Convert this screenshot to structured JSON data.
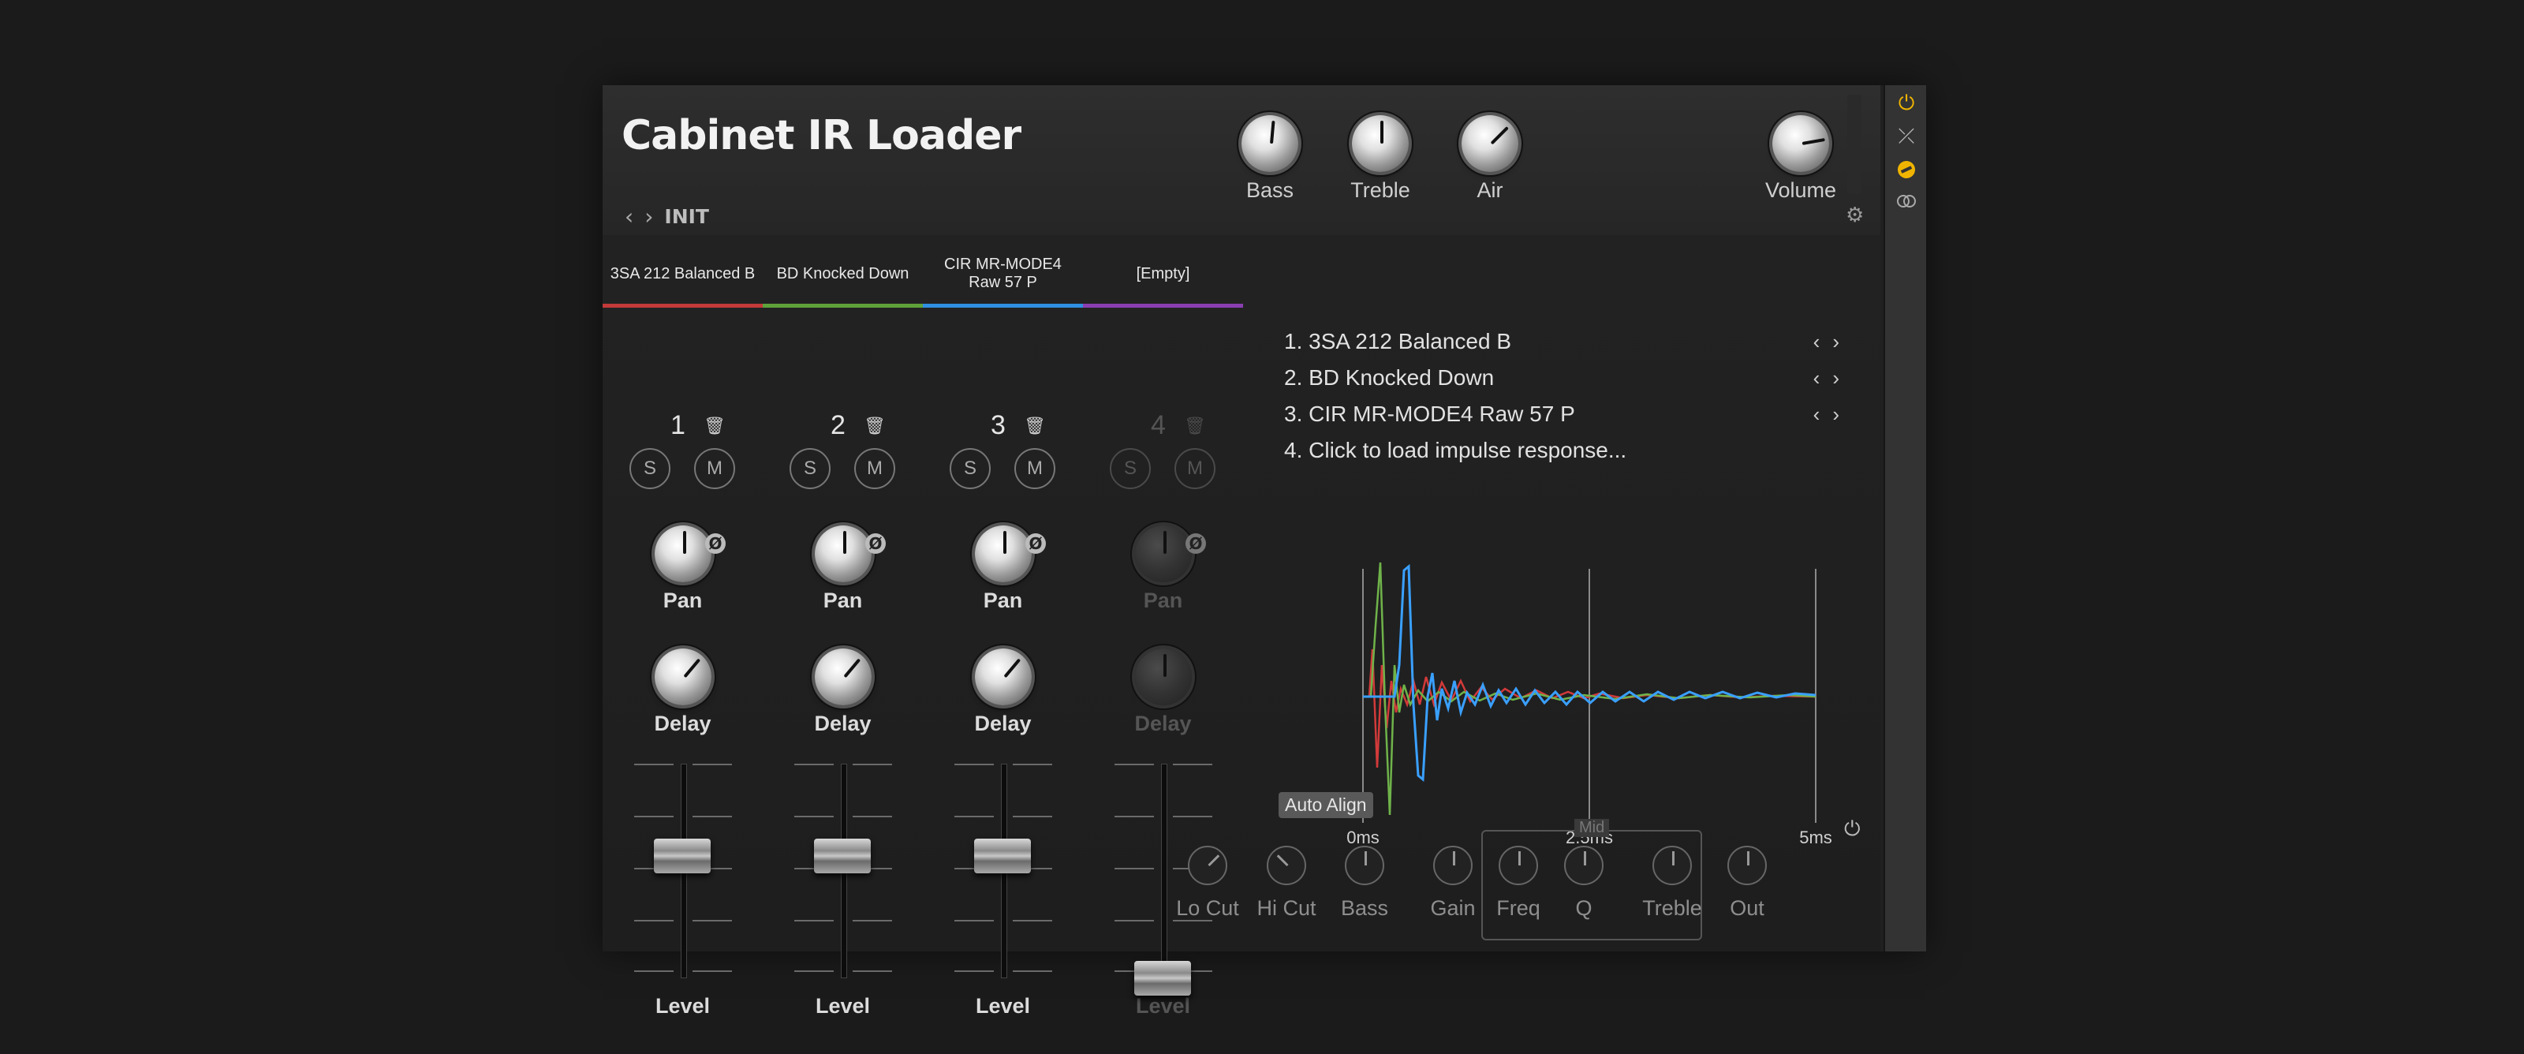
{
  "app": {
    "title": "Cabinet IR Loader",
    "preset": "INIT",
    "preset_prev": "‹",
    "preset_next": "›"
  },
  "header_knobs": [
    {
      "label": "Bass",
      "angle": 185
    },
    {
      "label": "Treble",
      "angle": 180
    },
    {
      "label": "Air",
      "angle": 225
    },
    {
      "label": "Volume",
      "angle": 260
    }
  ],
  "tabs": [
    {
      "label": "3SA 212 Balanced B",
      "color": "#c23a3a"
    },
    {
      "label": "BD Knocked Down",
      "color": "#5fa23a"
    },
    {
      "label": "CIR MR-MODE4 Raw 57 P",
      "color": "#2f8fe0"
    },
    {
      "label": "[Empty]",
      "color": "#8a3fb0"
    }
  ],
  "channels": [
    {
      "number": "1",
      "solo": "S",
      "mute": "M",
      "pan_label": "Pan",
      "delay_label": "Delay",
      "level_label": "Level",
      "phase": "Ø",
      "enabled": true,
      "level": 0.62
    },
    {
      "number": "2",
      "solo": "S",
      "mute": "M",
      "pan_label": "Pan",
      "delay_label": "Delay",
      "level_label": "Level",
      "phase": "Ø",
      "enabled": true,
      "level": 0.62
    },
    {
      "number": "3",
      "solo": "S",
      "mute": "M",
      "pan_label": "Pan",
      "delay_label": "Delay",
      "level_label": "Level",
      "phase": "Ø",
      "enabled": true,
      "level": 0.62
    },
    {
      "number": "4",
      "solo": "S",
      "mute": "M",
      "pan_label": "Pan",
      "delay_label": "Delay",
      "level_label": "Level",
      "phase": "Ø",
      "enabled": false,
      "level": 0.0
    }
  ],
  "ir_list": [
    {
      "text": "1. 3SA 212 Balanced B",
      "nav": true
    },
    {
      "text": "2. BD Knocked Down",
      "nav": true
    },
    {
      "text": "3. CIR MR-MODE4 Raw 57 P",
      "nav": true
    },
    {
      "text": "4. Click to load impulse response...",
      "nav": false
    }
  ],
  "graph": {
    "ticks": [
      "0ms",
      "2.5ms",
      "5ms"
    ],
    "series_colors": [
      "#d23a3a",
      "#6fb34a",
      "#3aa0ff"
    ]
  },
  "auto_align": "Auto Align",
  "eq": {
    "knobs": [
      "Lo Cut",
      "Hi Cut",
      "Bass",
      "Gain",
      "Freq",
      "Q",
      "Treble",
      "Out"
    ],
    "mid_label": "Mid"
  },
  "icons": {
    "trash": "trash-icon",
    "gear": "gear-icon",
    "power": "power-icon",
    "collapse": "collapse-icon",
    "tuner": "tuner-icon",
    "link": "link-icon"
  },
  "colors": {
    "accent": "#f0b400"
  }
}
